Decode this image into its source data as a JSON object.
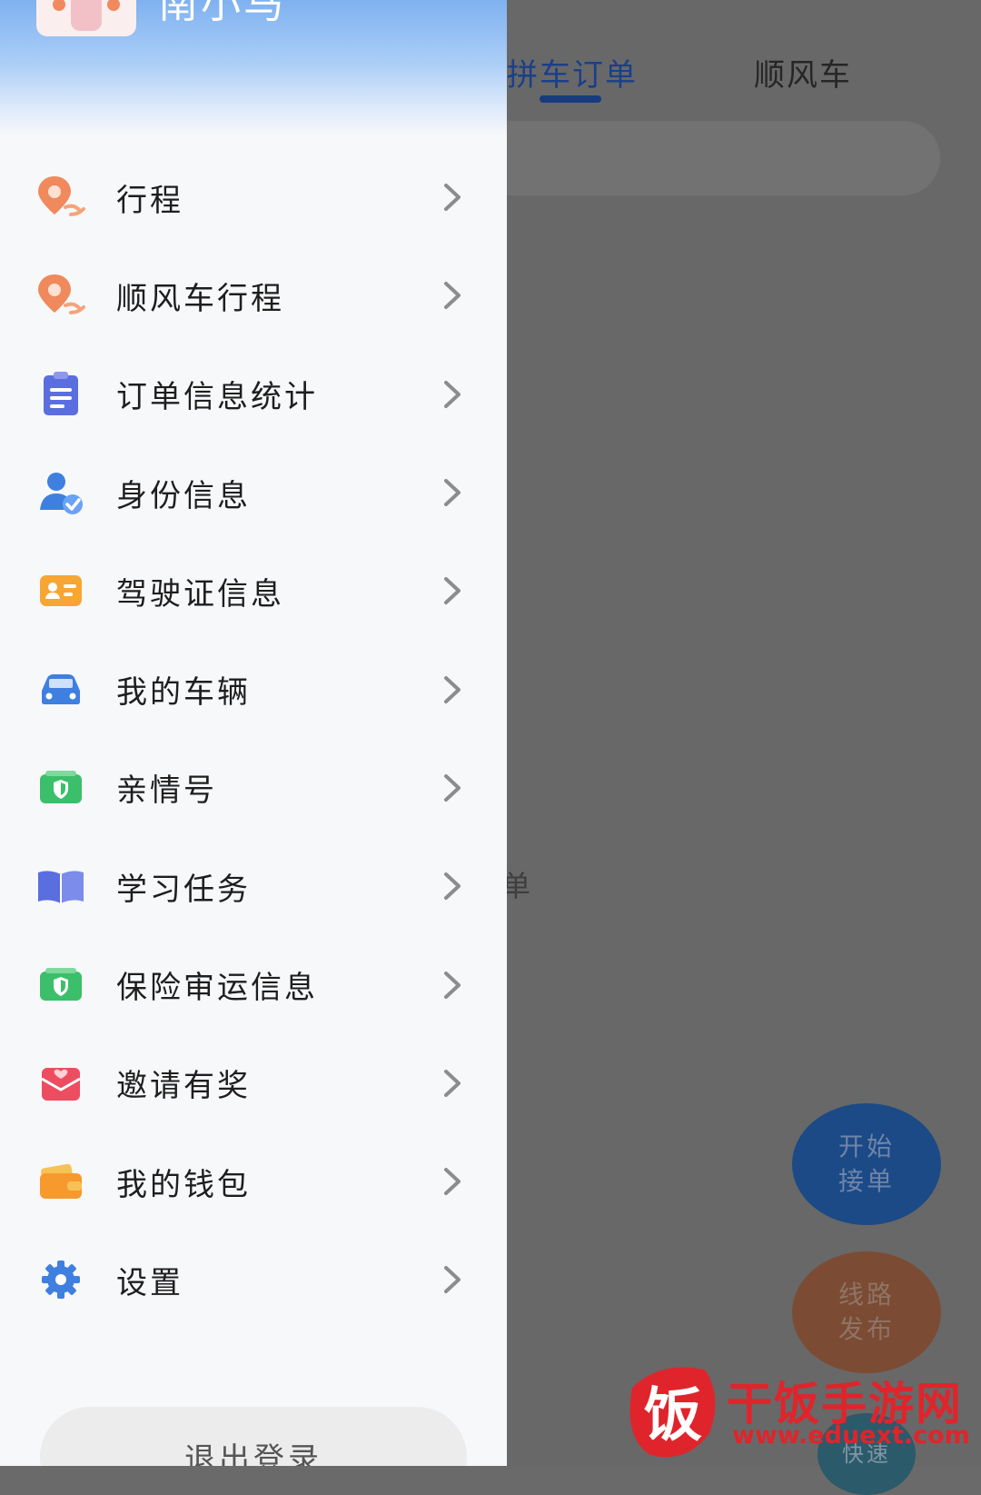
{
  "background": {
    "tabs": [
      "城拼车订单",
      "顺风车"
    ],
    "empty_text": "订单",
    "fab_start": [
      "开始",
      "接单"
    ],
    "fab_route": [
      "线路",
      "发布"
    ],
    "fab_third": "快速"
  },
  "drawer": {
    "username": "南小马",
    "menu_items": [
      {
        "label": "行程",
        "icon": "trip-pin-icon"
      },
      {
        "label": "顺风车行程",
        "icon": "carpool-trip-icon"
      },
      {
        "label": "订单信息统计",
        "icon": "clipboard-icon"
      },
      {
        "label": "身份信息",
        "icon": "user-verified-icon"
      },
      {
        "label": "驾驶证信息",
        "icon": "license-card-icon"
      },
      {
        "label": "我的车辆",
        "icon": "car-icon"
      },
      {
        "label": "亲情号",
        "icon": "shield-family-icon"
      },
      {
        "label": "学习任务",
        "icon": "book-icon"
      },
      {
        "label": "保险审运信息",
        "icon": "shield-insurance-icon"
      },
      {
        "label": "邀请有奖",
        "icon": "gift-envelope-icon"
      },
      {
        "label": "我的钱包",
        "icon": "wallet-icon"
      },
      {
        "label": "设置",
        "icon": "gear-icon"
      }
    ],
    "logout_label": "退出登录"
  },
  "watermark": {
    "logo_char": "饭",
    "text": "干饭手游网",
    "url": "www.eduext.com"
  },
  "colors": {
    "drawer_bg": "#f7f8fa",
    "header_blue": "#7fb1f0",
    "overlay_gray": "#686868",
    "active_tab": "#1a3f8a",
    "watermark_red": "#e0242b"
  }
}
